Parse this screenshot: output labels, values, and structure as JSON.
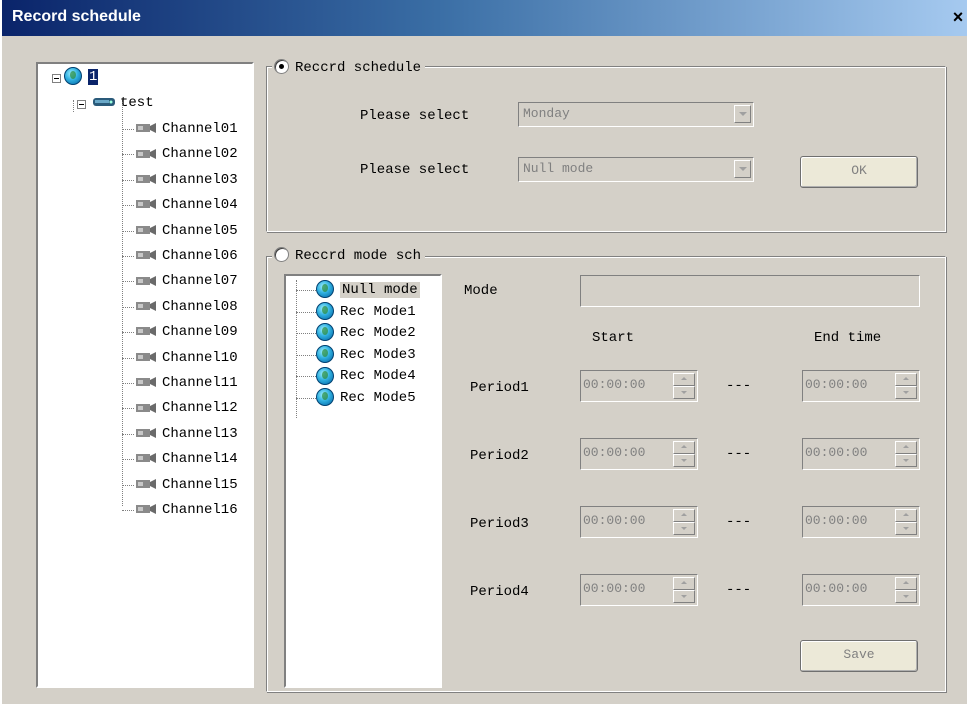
{
  "window": {
    "title": "Record schedule",
    "close_glyph": "×"
  },
  "tree": {
    "root_label": "1",
    "device_label": "test",
    "channels": [
      "Channel01",
      "Channel02",
      "Channel03",
      "Channel04",
      "Channel05",
      "Channel06",
      "Channel07",
      "Channel08",
      "Channel09",
      "Channel10",
      "Channel11",
      "Channel12",
      "Channel13",
      "Channel14",
      "Channel15",
      "Channel16"
    ]
  },
  "record_schedule": {
    "legend": "Reccrd schedule",
    "selected": true,
    "day_label": "Please select",
    "day_value": "Monday",
    "mode_label": "Please select",
    "mode_value": "Null mode",
    "ok_label": "OK"
  },
  "mode_schedule": {
    "legend": "Reccrd mode sch",
    "selected": false,
    "modes": [
      "Null mode",
      "Rec Mode1",
      "Rec Mode2",
      "Rec Mode3",
      "Rec Mode4",
      "Rec Mode5"
    ],
    "selected_mode": "Null mode",
    "mode_field_label": "Mode",
    "mode_field_value": "",
    "start_header": "Start",
    "end_header": "End time",
    "separator": "---",
    "periods": [
      {
        "label": "Period1",
        "start": "00:00:00",
        "end": "00:00:00"
      },
      {
        "label": "Period2",
        "start": "00:00:00",
        "end": "00:00:00"
      },
      {
        "label": "Period3",
        "start": "00:00:00",
        "end": "00:00:00"
      },
      {
        "label": "Period4",
        "start": "00:00:00",
        "end": "00:00:00"
      }
    ],
    "save_label": "Save"
  }
}
